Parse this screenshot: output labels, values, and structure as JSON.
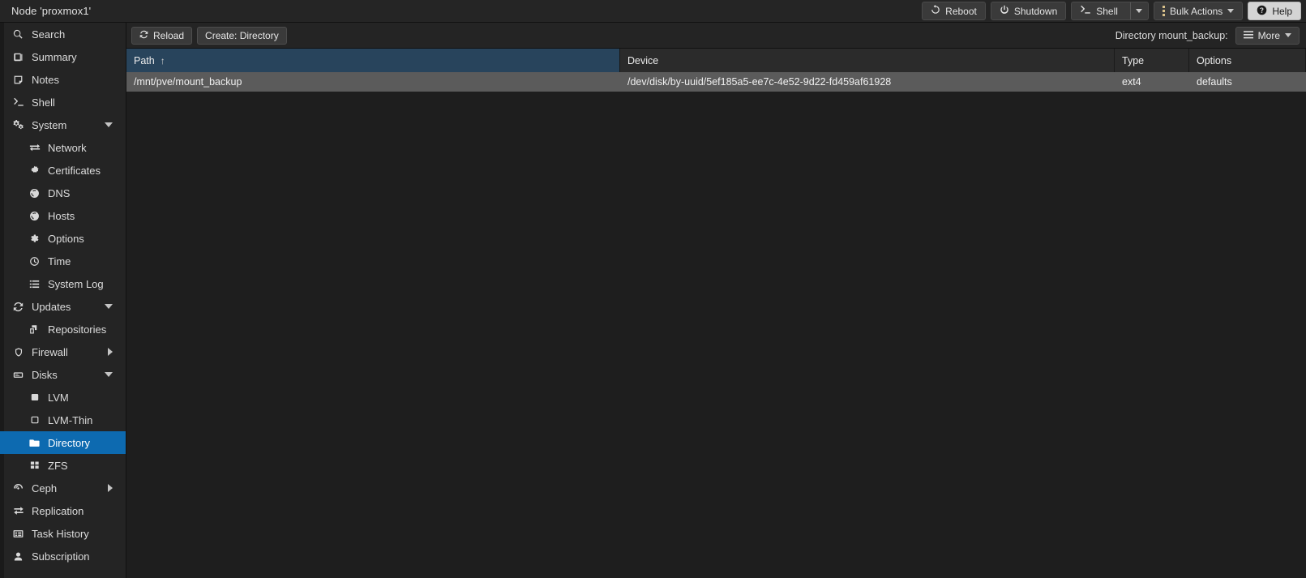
{
  "header": {
    "node_title": "Node 'proxmox1'",
    "actions": [
      {
        "id": "reboot",
        "label": "Reboot",
        "icon": "reboot-icon",
        "style": "normal",
        "dropdown": false
      },
      {
        "id": "shutdown",
        "label": "Shutdown",
        "icon": "power-icon",
        "style": "normal",
        "dropdown": false
      },
      {
        "id": "shell",
        "label": "Shell",
        "icon": "terminal-icon",
        "style": "split",
        "dropdown": true
      },
      {
        "id": "bulk-actions",
        "label": "Bulk Actions",
        "icon": "dots-vertical-icon",
        "style": "normal",
        "dropdown": true
      },
      {
        "id": "help",
        "label": "Help",
        "icon": "question-icon",
        "style": "light",
        "dropdown": false
      }
    ]
  },
  "sidebar": {
    "items": [
      {
        "label": "Search",
        "icon": "search-icon",
        "level": 0,
        "expand": "none",
        "selected": false
      },
      {
        "label": "Summary",
        "icon": "book-icon",
        "level": 0,
        "expand": "none",
        "selected": false
      },
      {
        "label": "Notes",
        "icon": "note-icon",
        "level": 0,
        "expand": "none",
        "selected": false
      },
      {
        "label": "Shell",
        "icon": "terminal-icon",
        "level": 0,
        "expand": "none",
        "selected": false
      },
      {
        "label": "System",
        "icon": "gears-icon",
        "level": 0,
        "expand": "expanded",
        "selected": false
      },
      {
        "label": "Network",
        "icon": "network-icon",
        "level": 1,
        "expand": "none",
        "selected": false
      },
      {
        "label": "Certificates",
        "icon": "certificate-icon",
        "level": 1,
        "expand": "none",
        "selected": false
      },
      {
        "label": "DNS",
        "icon": "globe-icon",
        "level": 1,
        "expand": "none",
        "selected": false
      },
      {
        "label": "Hosts",
        "icon": "globe-icon",
        "level": 1,
        "expand": "none",
        "selected": false
      },
      {
        "label": "Options",
        "icon": "gear-icon",
        "level": 1,
        "expand": "none",
        "selected": false
      },
      {
        "label": "Time",
        "icon": "clock-icon",
        "level": 1,
        "expand": "none",
        "selected": false
      },
      {
        "label": "System Log",
        "icon": "list-icon",
        "level": 1,
        "expand": "none",
        "selected": false
      },
      {
        "label": "Updates",
        "icon": "refresh-icon",
        "level": 0,
        "expand": "expanded",
        "selected": false
      },
      {
        "label": "Repositories",
        "icon": "repository-icon",
        "level": 1,
        "expand": "none",
        "selected": false
      },
      {
        "label": "Firewall",
        "icon": "shield-icon",
        "level": 0,
        "expand": "collapsed",
        "selected": false
      },
      {
        "label": "Disks",
        "icon": "disk-icon",
        "level": 0,
        "expand": "expanded",
        "selected": false
      },
      {
        "label": "LVM",
        "icon": "square-filled-icon",
        "level": 1,
        "expand": "none",
        "selected": false
      },
      {
        "label": "LVM-Thin",
        "icon": "square-icon",
        "level": 1,
        "expand": "none",
        "selected": false
      },
      {
        "label": "Directory",
        "icon": "folder-icon",
        "level": 1,
        "expand": "none",
        "selected": true
      },
      {
        "label": "ZFS",
        "icon": "grid-icon",
        "level": 1,
        "expand": "none",
        "selected": false
      },
      {
        "label": "Ceph",
        "icon": "ceph-icon",
        "level": 0,
        "expand": "collapsed",
        "selected": false
      },
      {
        "label": "Replication",
        "icon": "replication-icon",
        "level": 0,
        "expand": "none",
        "selected": false
      },
      {
        "label": "Task History",
        "icon": "history-icon",
        "level": 0,
        "expand": "none",
        "selected": false
      },
      {
        "label": "Subscription",
        "icon": "subscription-icon",
        "level": 0,
        "expand": "none",
        "selected": false
      }
    ]
  },
  "toolbar": {
    "reload_label": "Reload",
    "create_label": "Create: Directory",
    "right_label": "Directory mount_backup:",
    "more_label": "More"
  },
  "table": {
    "columns": [
      {
        "key": "path",
        "label": "Path",
        "sorted": true,
        "sort_dir": "asc"
      },
      {
        "key": "device",
        "label": "Device",
        "sorted": false,
        "sort_dir": ""
      },
      {
        "key": "type",
        "label": "Type",
        "sorted": false,
        "sort_dir": ""
      },
      {
        "key": "options",
        "label": "Options",
        "sorted": false,
        "sort_dir": ""
      }
    ],
    "sort_arrow_glyph": "↑",
    "rows": [
      {
        "path": "/mnt/pve/mount_backup",
        "device": "/dev/disk/by-uuid/5ef185a5-ee7c-4e52-9d22-fd459af61928",
        "type": "ext4",
        "options": "defaults",
        "selected": true
      }
    ]
  },
  "colors": {
    "accent_blue": "#0d6ab0",
    "header_sorted": "#28445c",
    "row_selected": "#5b5b5b",
    "content_bg": "#1e1e1e",
    "sidebar_bg": "#242424"
  }
}
